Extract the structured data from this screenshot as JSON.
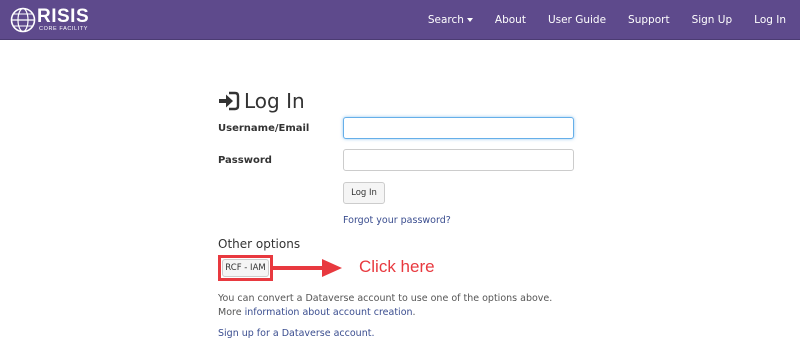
{
  "brand": {
    "name": "RISIS",
    "subtitle": "CORE FACILITY"
  },
  "nav": {
    "search": "Search",
    "about": "About",
    "user_guide": "User Guide",
    "support": "Support",
    "sign_up": "Sign Up",
    "log_in": "Log In"
  },
  "page": {
    "title": "Log In"
  },
  "form": {
    "username_label": "Username/Email",
    "username_value": "",
    "password_label": "Password",
    "password_value": "",
    "submit_label": "Log In",
    "forgot_link": "Forgot your password?"
  },
  "other": {
    "title": "Other options",
    "rcf_button": "RCF - IAM",
    "annotation": "Click here"
  },
  "info": {
    "text": "You can convert a Dataverse account to use one of the options above. More",
    "link": "information about account creation",
    "suffix": "."
  },
  "signup_link": "Sign up for a Dataverse account.",
  "colors": {
    "navbar": "#5e4a8c",
    "link": "#3a4d8f",
    "annotation": "#e8393f"
  }
}
